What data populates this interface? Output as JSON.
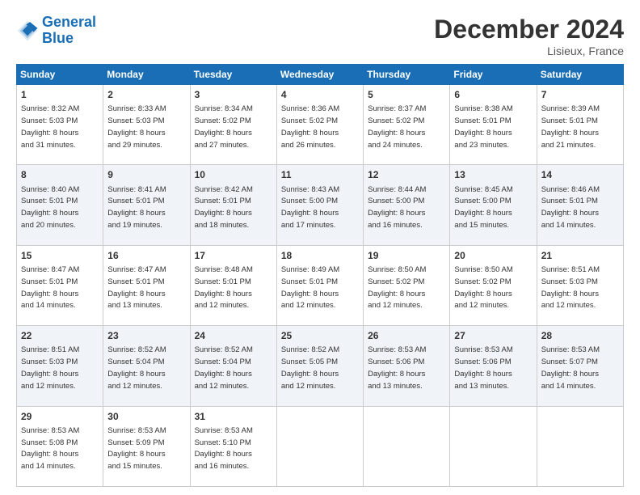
{
  "logo": {
    "line1": "General",
    "line2": "Blue"
  },
  "header": {
    "month": "December 2024",
    "location": "Lisieux, France"
  },
  "weekdays": [
    "Sunday",
    "Monday",
    "Tuesday",
    "Wednesday",
    "Thursday",
    "Friday",
    "Saturday"
  ],
  "weeks": [
    [
      {
        "day": 1,
        "sunrise": "8:32 AM",
        "sunset": "5:03 PM",
        "daylight": "8 hours and 31 minutes."
      },
      {
        "day": 2,
        "sunrise": "8:33 AM",
        "sunset": "5:03 PM",
        "daylight": "8 hours and 29 minutes."
      },
      {
        "day": 3,
        "sunrise": "8:34 AM",
        "sunset": "5:02 PM",
        "daylight": "8 hours and 27 minutes."
      },
      {
        "day": 4,
        "sunrise": "8:36 AM",
        "sunset": "5:02 PM",
        "daylight": "8 hours and 26 minutes."
      },
      {
        "day": 5,
        "sunrise": "8:37 AM",
        "sunset": "5:02 PM",
        "daylight": "8 hours and 24 minutes."
      },
      {
        "day": 6,
        "sunrise": "8:38 AM",
        "sunset": "5:01 PM",
        "daylight": "8 hours and 23 minutes."
      },
      {
        "day": 7,
        "sunrise": "8:39 AM",
        "sunset": "5:01 PM",
        "daylight": "8 hours and 21 minutes."
      }
    ],
    [
      {
        "day": 8,
        "sunrise": "8:40 AM",
        "sunset": "5:01 PM",
        "daylight": "8 hours and 20 minutes."
      },
      {
        "day": 9,
        "sunrise": "8:41 AM",
        "sunset": "5:01 PM",
        "daylight": "8 hours and 19 minutes."
      },
      {
        "day": 10,
        "sunrise": "8:42 AM",
        "sunset": "5:01 PM",
        "daylight": "8 hours and 18 minutes."
      },
      {
        "day": 11,
        "sunrise": "8:43 AM",
        "sunset": "5:00 PM",
        "daylight": "8 hours and 17 minutes."
      },
      {
        "day": 12,
        "sunrise": "8:44 AM",
        "sunset": "5:00 PM",
        "daylight": "8 hours and 16 minutes."
      },
      {
        "day": 13,
        "sunrise": "8:45 AM",
        "sunset": "5:00 PM",
        "daylight": "8 hours and 15 minutes."
      },
      {
        "day": 14,
        "sunrise": "8:46 AM",
        "sunset": "5:01 PM",
        "daylight": "8 hours and 14 minutes."
      }
    ],
    [
      {
        "day": 15,
        "sunrise": "8:47 AM",
        "sunset": "5:01 PM",
        "daylight": "8 hours and 14 minutes."
      },
      {
        "day": 16,
        "sunrise": "8:47 AM",
        "sunset": "5:01 PM",
        "daylight": "8 hours and 13 minutes."
      },
      {
        "day": 17,
        "sunrise": "8:48 AM",
        "sunset": "5:01 PM",
        "daylight": "8 hours and 12 minutes."
      },
      {
        "day": 18,
        "sunrise": "8:49 AM",
        "sunset": "5:01 PM",
        "daylight": "8 hours and 12 minutes."
      },
      {
        "day": 19,
        "sunrise": "8:50 AM",
        "sunset": "5:02 PM",
        "daylight": "8 hours and 12 minutes."
      },
      {
        "day": 20,
        "sunrise": "8:50 AM",
        "sunset": "5:02 PM",
        "daylight": "8 hours and 12 minutes."
      },
      {
        "day": 21,
        "sunrise": "8:51 AM",
        "sunset": "5:03 PM",
        "daylight": "8 hours and 12 minutes."
      }
    ],
    [
      {
        "day": 22,
        "sunrise": "8:51 AM",
        "sunset": "5:03 PM",
        "daylight": "8 hours and 12 minutes."
      },
      {
        "day": 23,
        "sunrise": "8:52 AM",
        "sunset": "5:04 PM",
        "daylight": "8 hours and 12 minutes."
      },
      {
        "day": 24,
        "sunrise": "8:52 AM",
        "sunset": "5:04 PM",
        "daylight": "8 hours and 12 minutes."
      },
      {
        "day": 25,
        "sunrise": "8:52 AM",
        "sunset": "5:05 PM",
        "daylight": "8 hours and 12 minutes."
      },
      {
        "day": 26,
        "sunrise": "8:53 AM",
        "sunset": "5:06 PM",
        "daylight": "8 hours and 13 minutes."
      },
      {
        "day": 27,
        "sunrise": "8:53 AM",
        "sunset": "5:06 PM",
        "daylight": "8 hours and 13 minutes."
      },
      {
        "day": 28,
        "sunrise": "8:53 AM",
        "sunset": "5:07 PM",
        "daylight": "8 hours and 14 minutes."
      }
    ],
    [
      {
        "day": 29,
        "sunrise": "8:53 AM",
        "sunset": "5:08 PM",
        "daylight": "8 hours and 14 minutes."
      },
      {
        "day": 30,
        "sunrise": "8:53 AM",
        "sunset": "5:09 PM",
        "daylight": "8 hours and 15 minutes."
      },
      {
        "day": 31,
        "sunrise": "8:53 AM",
        "sunset": "5:10 PM",
        "daylight": "8 hours and 16 minutes."
      },
      null,
      null,
      null,
      null
    ]
  ]
}
